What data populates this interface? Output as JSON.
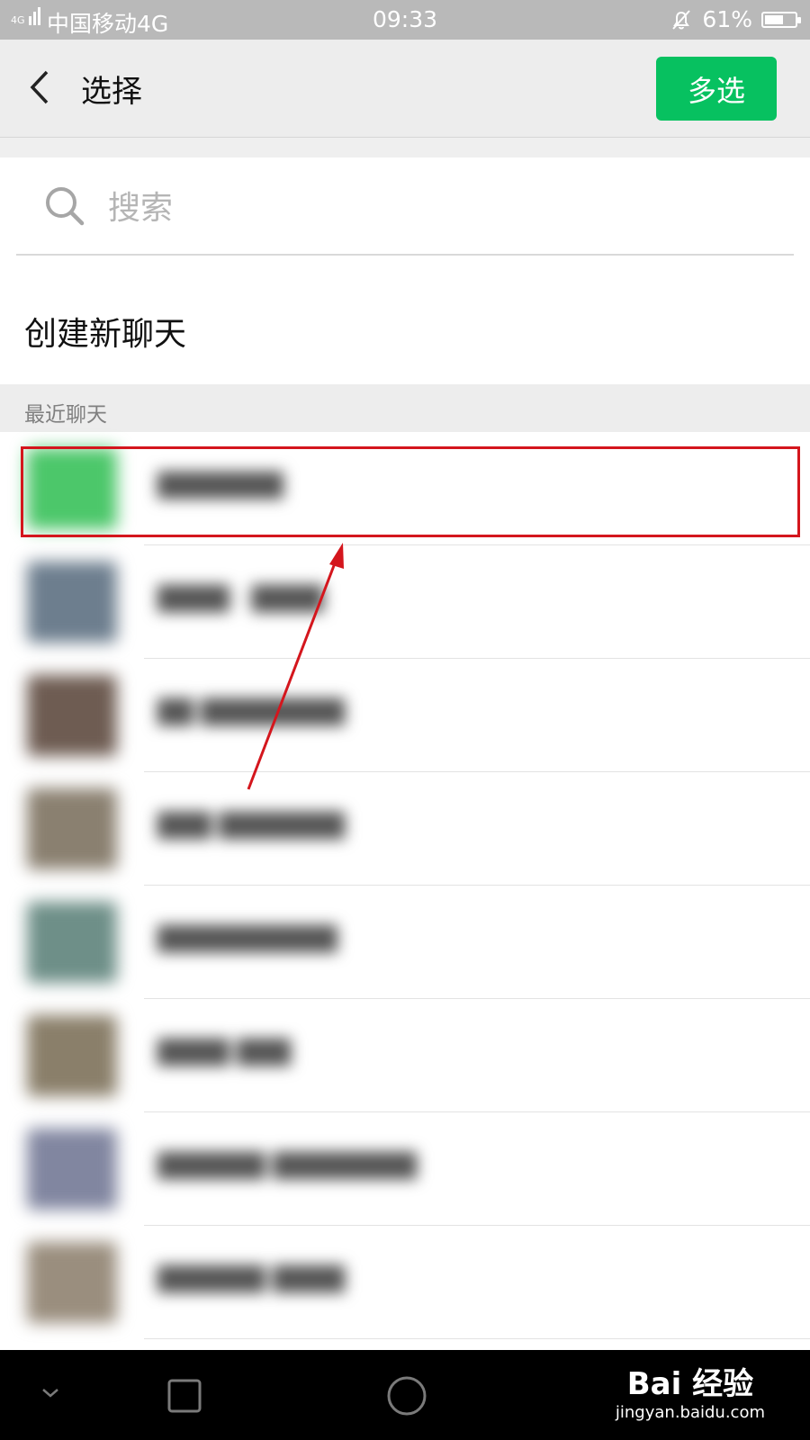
{
  "status_bar": {
    "network": "4G",
    "carrier": "中国移动4G",
    "time": "09:33",
    "battery": "61%",
    "battery_level": 0.61
  },
  "header": {
    "title": "选择",
    "multi_select_label": "多选"
  },
  "search": {
    "placeholder": "搜索"
  },
  "create_chat_label": "创建新聊天",
  "recent_section_label": "最近聊天",
  "recent_chats": [
    {
      "name": "███████",
      "avatar_color": "#4cc76a",
      "highlighted": true
    },
    {
      "name": "████ · ████",
      "avatar_color": "#6d7e8e"
    },
    {
      "name": "██ ████████",
      "avatar_color": "#6e5c52"
    },
    {
      "name": "███ ███████",
      "avatar_color": "#8a8070"
    },
    {
      "name": "██████████",
      "avatar_color": "#6e8f88"
    },
    {
      "name": "████ ███",
      "avatar_color": "#8a7f6a"
    },
    {
      "name": "██████ ████████",
      "avatar_color": "#8186a0"
    },
    {
      "name": "██████ ████",
      "avatar_color": "#9a8e7e"
    }
  ],
  "annotation": {
    "color": "#d4161d"
  },
  "nav_bar": {
    "icons": [
      "chevron-down-icon",
      "recent-apps-icon",
      "home-icon"
    ]
  },
  "watermark": {
    "logo": "Bai 经验",
    "url": "jingyan.baidu.com"
  }
}
